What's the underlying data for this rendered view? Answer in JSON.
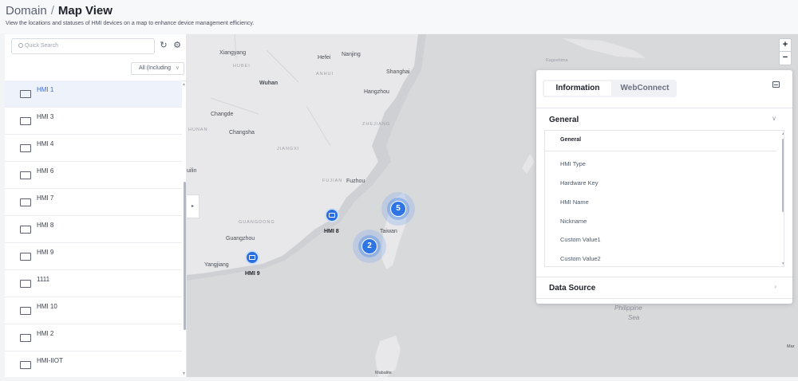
{
  "header": {
    "breadcrumb_root": "Domain",
    "breadcrumb_sep": "/",
    "title": "Map View",
    "subtitle": "View the locations and statuses of HMI devices on a map to enhance device management efficiency."
  },
  "sidebar": {
    "search_placeholder": "Quick Search",
    "filter_value": "All (Including",
    "icons": [
      "refresh-icon",
      "settings-icon"
    ],
    "items": [
      {
        "label": "HMI 1",
        "selected": true
      },
      {
        "label": "HMI 3"
      },
      {
        "label": "HMI 4"
      },
      {
        "label": "HMI 6"
      },
      {
        "label": "HMI 7"
      },
      {
        "label": "HMI 8"
      },
      {
        "label": "HMI 9"
      },
      {
        "label": "1111"
      },
      {
        "label": "HMI 10"
      },
      {
        "label": "HMI 2"
      },
      {
        "label": "HMI-IIOT"
      }
    ]
  },
  "map": {
    "labels": {
      "xiangyang": "Xiangyang",
      "hubei": "HUBEI",
      "hefei": "Hefei",
      "anhui": "ANHUI",
      "nanjing": "Nanjing",
      "shanghai": "Shanghai",
      "wuhan": "Wuhan",
      "hangzhou": "Hangzhou",
      "changde": "Changde",
      "hunan": "HUNAN",
      "changsha": "Changsha",
      "zhejiang": "ZHEJIANG",
      "jiangxi": "JIANGXI",
      "fujian": "FUJIAN",
      "fuzhou": "Fuzhou",
      "guangdong": "GUANGDONG",
      "guangzhou": "Guangzhou",
      "yangjiang": "Yangjiang",
      "taiwan": "Taiwan",
      "philippine_sea": "Philippine",
      "philippine_sea2": "Sea",
      "kagoshima": "Kagoshima",
      "guilin": "uilin",
      "mabalite": "Mabalite",
      "mar": "Mar"
    },
    "markers": [
      {
        "label": "HMI 8"
      },
      {
        "label": "HMI 9"
      }
    ],
    "clusters": [
      {
        "count": "5"
      },
      {
        "count": "2"
      }
    ],
    "zoom_in": "+",
    "zoom_out": "−",
    "collapse_glyph": "▸"
  },
  "info_panel": {
    "tabs": [
      "Information",
      "WebConnect"
    ],
    "sections": {
      "general": "General",
      "data_source": "Data Source"
    },
    "general_header": "General",
    "fields": [
      "HMI Type",
      "Hardware Key",
      "HMI Name",
      "Nickname",
      "Custom Value1",
      "Custom Value2"
    ],
    "colors": {
      "accent": "#2f74e4",
      "selected_text": "#3a6bd6"
    }
  }
}
